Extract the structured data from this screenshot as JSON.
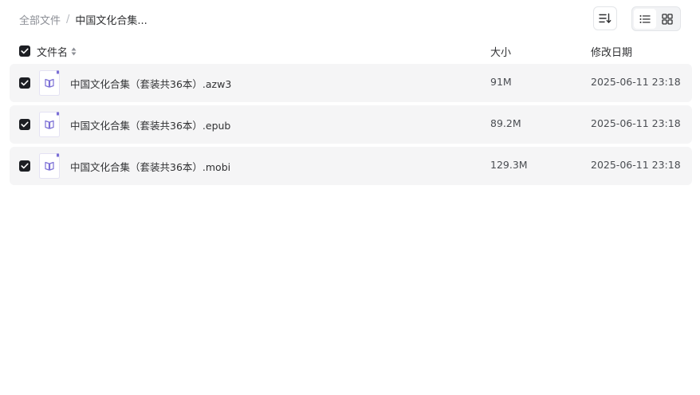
{
  "breadcrumb": {
    "root": "全部文件",
    "separator": "/",
    "current": "中国文化合集..."
  },
  "toolbar": {
    "sort_icon": "sort-icon",
    "view_list_icon": "list-view-icon",
    "view_grid_icon": "grid-view-icon",
    "active_view": "list"
  },
  "header": {
    "name": "文件名",
    "size": "大小",
    "modified": "修改日期",
    "all_checked": true
  },
  "files": [
    {
      "name": "中国文化合集（套装共36本）.azw3",
      "size": "91M",
      "modified": "2025-06-11 23:18",
      "checked": true,
      "icon": "ebook-file-icon"
    },
    {
      "name": "中国文化合集（套装共36本）.epub",
      "size": "89.2M",
      "modified": "2025-06-11 23:18",
      "checked": true,
      "icon": "ebook-file-icon"
    },
    {
      "name": "中国文化合集（套装共36本）.mobi",
      "size": "129.3M",
      "modified": "2025-06-11 23:18",
      "checked": true,
      "icon": "ebook-file-icon"
    }
  ],
  "colors": {
    "row_background": "#f5f5f6",
    "checkbox_checked": "#1d1f24",
    "file_icon_accent": "#7b6fd6"
  }
}
